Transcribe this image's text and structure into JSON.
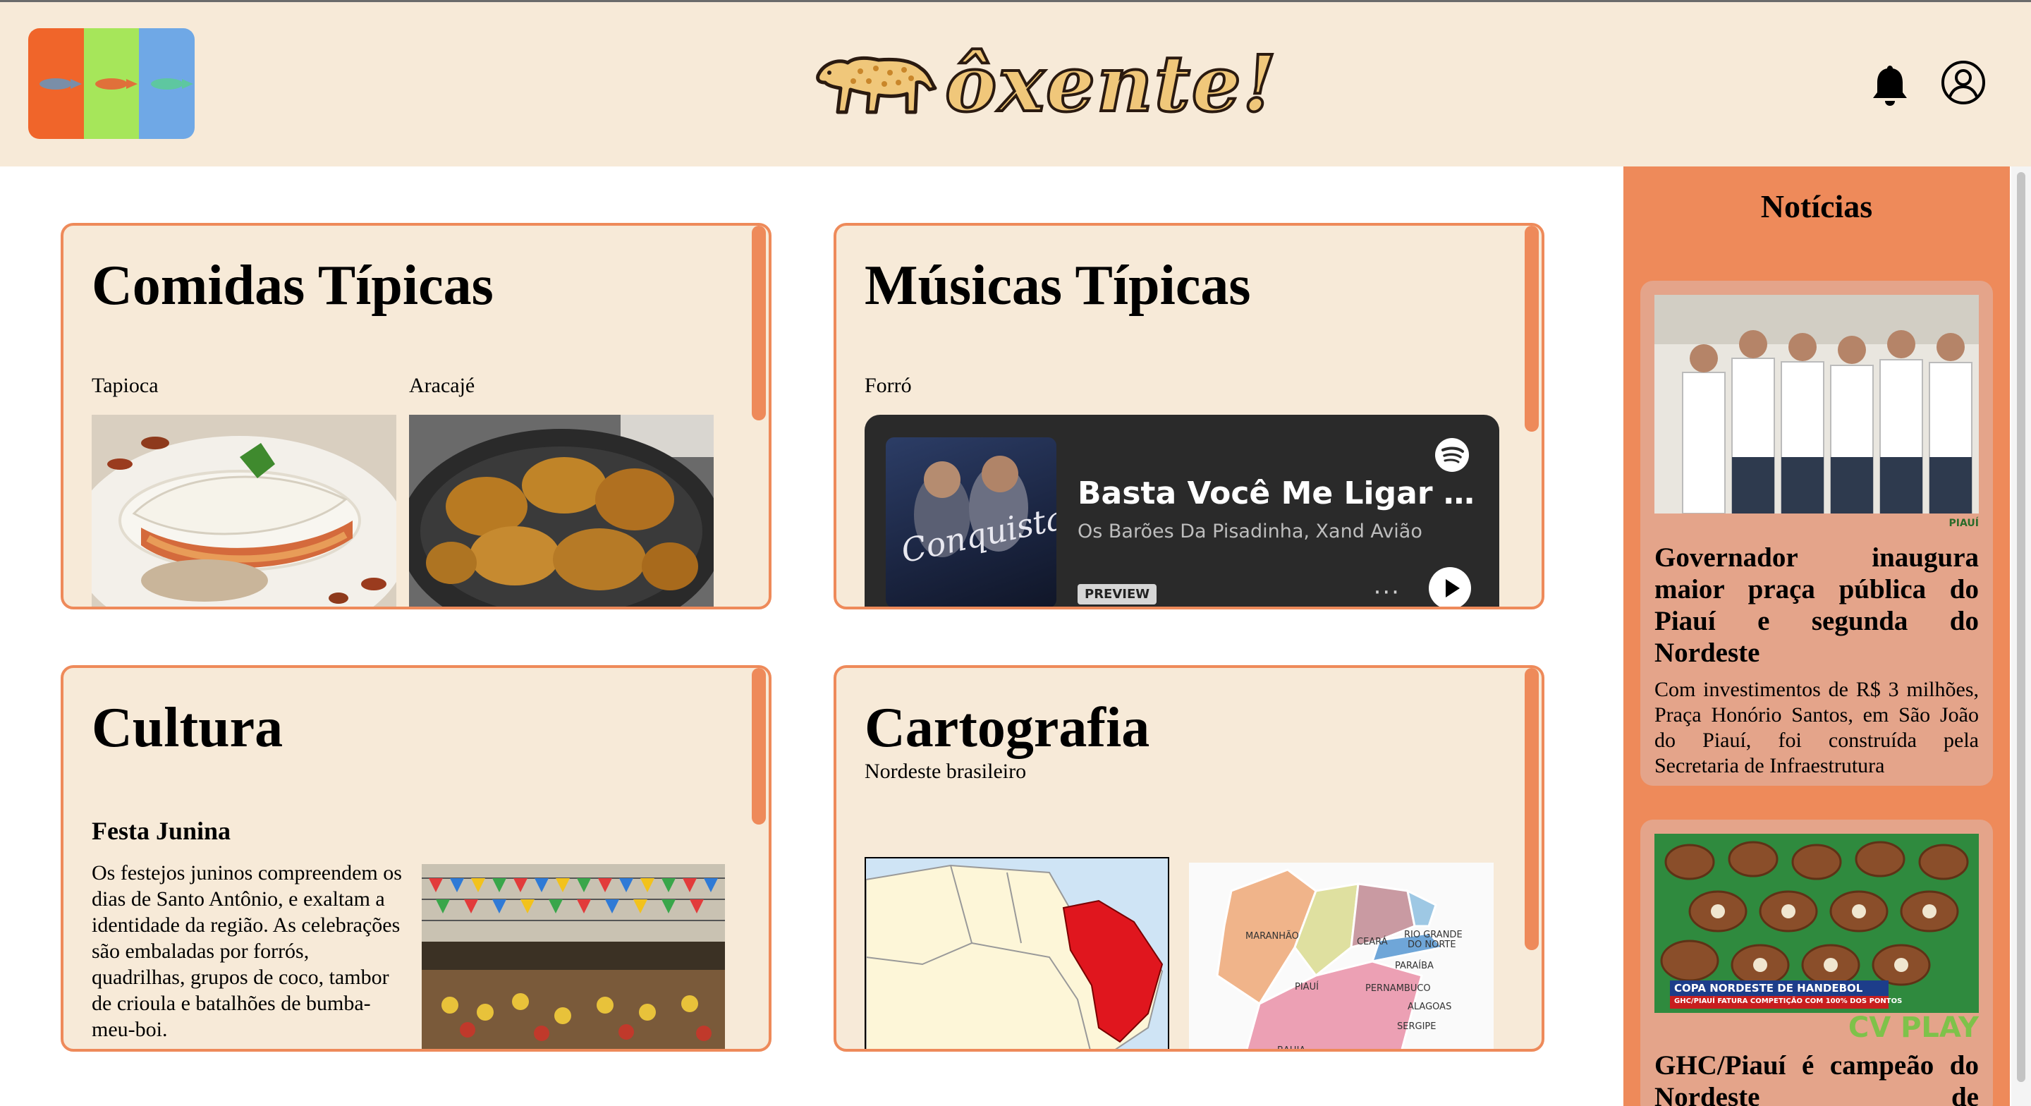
{
  "header": {
    "brand_name": "ôxente!",
    "logo_icon": "jaguar-icon",
    "flag_colors": [
      "#f0652a",
      "#a6e65a",
      "#6fa8e6"
    ],
    "fish_colors": [
      "#7a8ea8",
      "#e0703a",
      "#5ec7a0"
    ],
    "notifications_icon": "bell-icon",
    "profile_icon": "user-circle-icon"
  },
  "cards": {
    "comidas": {
      "title": "Comidas Típicas",
      "items": [
        {
          "label": "Tapioca"
        },
        {
          "label": "Aracajé"
        }
      ]
    },
    "musicas": {
      "title": "Músicas Típicas",
      "genre": "Forró",
      "player": {
        "album_title": "Conquistas",
        "song": "Basta Você Me Ligar - Ao Vivo",
        "artist": "Os Barões Da Pisadinha, Xand Avião",
        "badge": "PREVIEW",
        "more": "···"
      }
    },
    "cultura": {
      "title": "Cultura",
      "subtitle": "Festa Junina",
      "text": "Os festejos juninos compreendem os dias de Santo Antônio, e exaltam a identidade da região. As celebrações são embaladas por forrós, quadrilhas, grupos de coco, tambor de crioula e batalhões de bumba-meu-boi."
    },
    "cartografia": {
      "title": "Cartografia",
      "subtitle": "Nordeste brasileiro",
      "map_states": [
        "MARANHÃO",
        "CEARÁ",
        "RIO GRANDE",
        "DO NORTE",
        "PARAÍBA",
        "PIAUÍ",
        "PERNAMBUCO",
        "ALAGOAS",
        "SERGIPE",
        "BAHIA"
      ]
    }
  },
  "news": {
    "title": "Notícias",
    "items": [
      {
        "headline": "Governador inaugura maior praça pública do Piauí e segunda do Nordeste",
        "body": "Com investimentos de R$ 3 milhões, Praça Honório Santos, em São João do Piauí, foi construída pela Secretaria de Infraestrutura",
        "watermark": "PIAUÍ"
      },
      {
        "headline": "GHC/Piauí é campeão do Nordeste de",
        "overlay_top": "COPA NORDESTE DE HANDEBOL",
        "overlay_bottom": "GHC/PIAUÍ FATURA COMPETIÇÃO COM 100% DOS PONTOS",
        "watermark": "CV PLAY"
      }
    ]
  }
}
